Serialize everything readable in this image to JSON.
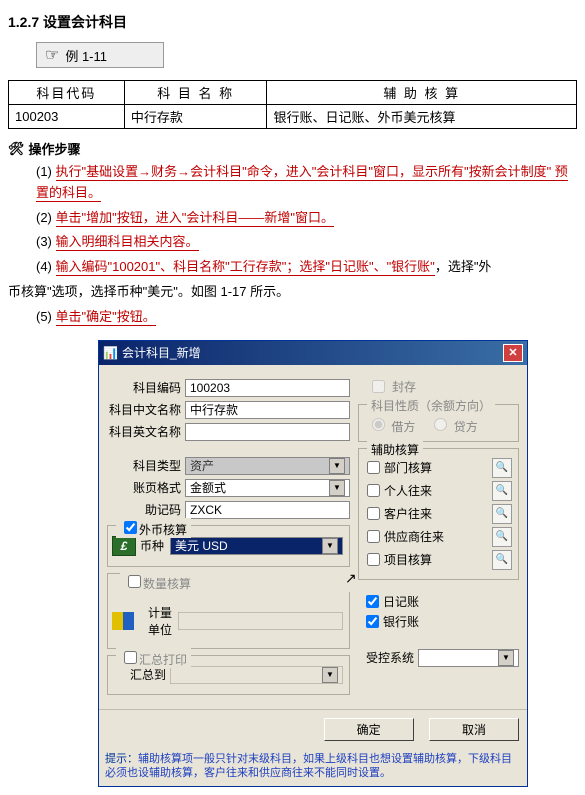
{
  "section_title": "1.2.7  设置会计科目",
  "example_label": "例 1-11",
  "table": {
    "headers": [
      "科目代码",
      "科 目 名 称",
      "辅 助 核 算"
    ],
    "row": [
      "100203",
      "中行存款",
      "银行账、日记账、外币美元核算"
    ]
  },
  "ops_head": "操作步骤",
  "steps": {
    "s1_pre": "(1) ",
    "s1_red": "执行\"基础设置→财务→会计科目\"命令，进入\"会计科目\"窗口，显示所有\"按新会计制度\"  预置的科目。",
    "s2_pre": "(2) ",
    "s2_red": "单击\"增加\"按钮，进入\"会计科目——新增\"窗口。",
    "s3_pre": "(3) ",
    "s3_red": "输入明细科目相关内容。",
    "s4_pre": "(4) ",
    "s4_red": "输入编码\"100201\"、科目名称\"工行存款\"；选择\"日记账\"、\"银行账\"",
    "s4_tail1": "，选择\"外",
    "s4_line2_head": "币核算\"选项，选择币种\"美元\"。",
    "s4_tail2": "如图 1-17 所示。",
    "s5_pre": "(5) ",
    "s5_red": "单击\"确定\"按钮。"
  },
  "dialog": {
    "title": "会计科目_新增",
    "fields": {
      "code_label": "科目编码",
      "code_value": "100203",
      "cname_label": "科目中文名称",
      "cname_value": "中行存款",
      "ename_label": "科目英文名称",
      "ename_value": "",
      "type_label": "科目类型",
      "type_value": "资产",
      "ledger_label": "账页格式",
      "ledger_value": "金额式",
      "mnemo_label": "助记码",
      "mnemo_value": "ZXCK",
      "curr_group": "外币核算",
      "curr_label": "币种",
      "curr_value": "美元  USD",
      "qty_group": "数量核算",
      "qty_label": "计量单位",
      "qty_value": "",
      "hz_group": "汇总打印",
      "hz_label": "汇总到",
      "hz_value": ""
    },
    "right": {
      "sealed": "封存",
      "prop_group": "科目性质（余额方向）",
      "prop_debit": "借方",
      "prop_credit": "贷方",
      "aux_group": "辅助核算",
      "aux_items": [
        "部门核算",
        "个人往来",
        "客户往来",
        "供应商往来",
        "项目核算"
      ],
      "chk_journal": "日记账",
      "chk_bank": "银行账",
      "ctrl_label": "受控系统",
      "ctrl_value": ""
    },
    "buttons": {
      "ok": "确定",
      "cancel": "取消"
    },
    "hint_label": "提示：",
    "hint_text": "辅助核算项一般只针对末级科目，如果上级科目也想设置辅助核算，下级科目必须也设辅助核算，客户往来和供应商往来不能同时设置。"
  }
}
